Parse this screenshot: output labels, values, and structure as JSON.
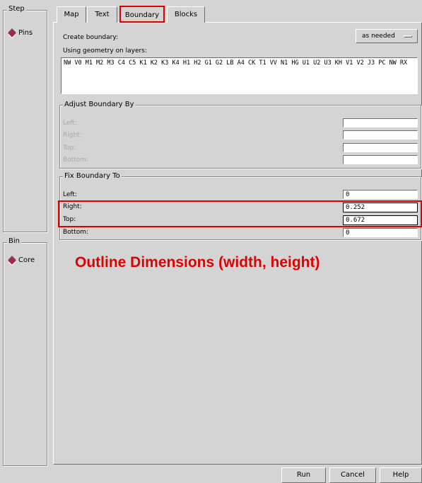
{
  "step_panel": {
    "title": "Step",
    "item": "Pins"
  },
  "bin_panel": {
    "title": "Bin",
    "item": "Core"
  },
  "tabs": [
    {
      "label": "Map"
    },
    {
      "label": "Text"
    },
    {
      "label": "Boundary"
    },
    {
      "label": "Blocks"
    }
  ],
  "create_boundary": {
    "label": "Create boundary:",
    "value": "as needed"
  },
  "layers": {
    "label": "Using geometry on layers:",
    "value": "NW V0 M1 M2 M3 C4 C5 K1 K2 K3 K4 H1 H2 G1 G2 LB A4 CK T1 VV N1 HG U1 U2 U3 KH V1 V2 J3 PC NW RX"
  },
  "adjust": {
    "title": "Adjust Boundary By",
    "left_label": "Left:",
    "right_label": "Right:",
    "top_label": "Top:",
    "bottom_label": "Bottom:"
  },
  "fix": {
    "title": "Fix Boundary To",
    "left_label": "Left:",
    "left_value": "0",
    "right_label": "Right:",
    "right_value": "0.252",
    "top_label": "Top:",
    "top_value": "0.672",
    "bottom_label": "Bottom:",
    "bottom_value": "0"
  },
  "annotation": "Outline Dimensions (width, height)",
  "buttons": {
    "run": "Run",
    "cancel": "Cancel",
    "help": "Help"
  },
  "colors": {
    "highlight": "#e00000",
    "background": "#d4d4d4",
    "radio": "#a3264c"
  }
}
